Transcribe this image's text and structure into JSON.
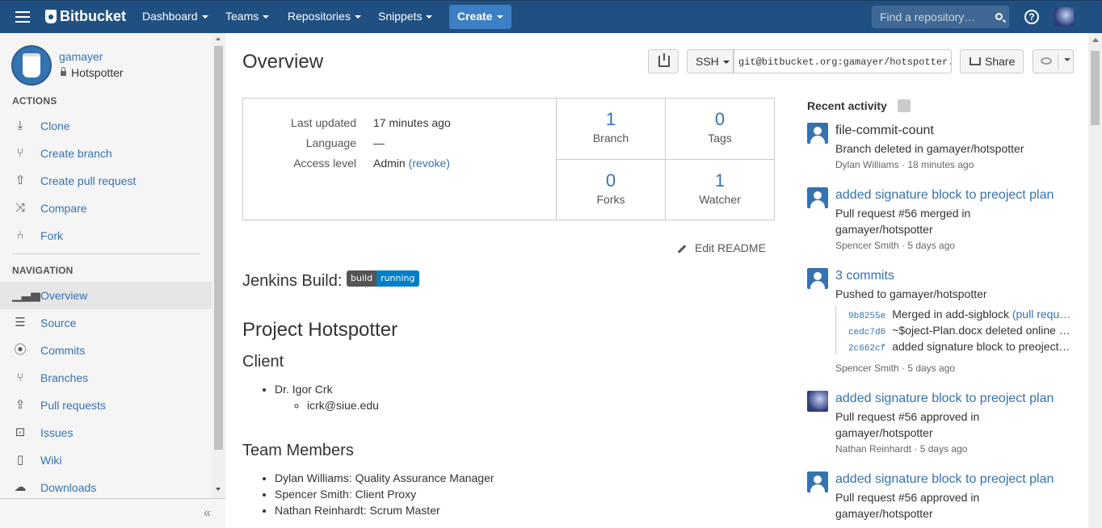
{
  "header": {
    "logo": "Bitbucket",
    "nav": [
      "Dashboard",
      "Teams",
      "Repositories",
      "Snippets"
    ],
    "create_label": "Create",
    "search_placeholder": "Find a repository…",
    "help_label": "?"
  },
  "sidebar": {
    "owner": "gamayer",
    "repo": "Hotspotter",
    "actions_title": "ACTIONS",
    "actions": [
      {
        "label": "Clone",
        "icon": "download-icon"
      },
      {
        "label": "Create branch",
        "icon": "create-branch-icon"
      },
      {
        "label": "Create pull request",
        "icon": "create-pull-request-icon"
      },
      {
        "label": "Compare",
        "icon": "compare-icon"
      },
      {
        "label": "Fork",
        "icon": "fork-icon"
      }
    ],
    "navigation_title": "NAVIGATION",
    "navigation": [
      {
        "label": "Overview",
        "icon": "overview-icon",
        "active": true
      },
      {
        "label": "Source",
        "icon": "source-icon"
      },
      {
        "label": "Commits",
        "icon": "commits-icon"
      },
      {
        "label": "Branches",
        "icon": "branches-icon"
      },
      {
        "label": "Pull requests",
        "icon": "pull-requests-icon"
      },
      {
        "label": "Issues",
        "icon": "issues-icon"
      },
      {
        "label": "Wiki",
        "icon": "wiki-icon"
      },
      {
        "label": "Downloads",
        "icon": "downloads-icon"
      }
    ],
    "collapse_label": "«"
  },
  "main": {
    "title": "Overview",
    "protocol": "SSH",
    "clone_url": "git@bitbucket.org:gamayer/hotspotter.git",
    "share_label": "Share",
    "meta": {
      "last_updated_key": "Last updated",
      "last_updated_val": "17 minutes ago",
      "language_key": "Language",
      "language_val": "—",
      "access_key": "Access level",
      "access_val": "Admin",
      "revoke_label": "(revoke)"
    },
    "stats": {
      "branch_count": "1",
      "branch_label": "Branch",
      "tags_count": "0",
      "tags_label": "Tags",
      "forks_count": "0",
      "forks_label": "Forks",
      "watcher_count": "1",
      "watcher_label": "Watcher"
    },
    "edit_readme": "Edit README",
    "readme": {
      "jenkins_label": "Jenkins Build:",
      "badge_left": "build",
      "badge_right": "running",
      "project_title": "Project Hotspotter",
      "client_heading": "Client",
      "client_name": "Dr. Igor Crk",
      "client_email": "icrk@siue.edu",
      "team_heading": "Team Members",
      "team": [
        "Dylan Williams: Quality Assurance Manager",
        "Spencer Smith: Client Proxy",
        "Nathan Reinhardt: Scrum Master"
      ]
    }
  },
  "activity": {
    "title": "Recent activity",
    "items": [
      {
        "head": "file-commit-count",
        "text": "Branch deleted in gamayer/hotspotter",
        "meta": "Dylan Williams · 18 minutes ago"
      },
      {
        "head": "added signature block to preoject plan",
        "text": "Pull request #56 merged in gamayer/hotspotter",
        "meta": "Spencer Smith · 5 days ago"
      },
      {
        "head": "3 commits",
        "text": "Pushed to gamayer/hotspotter",
        "meta": "Spencer Smith · 5 days ago"
      },
      {
        "head": "added signature block to preoject plan",
        "text": "Pull request #56 approved in gamayer/hotspotter",
        "meta": "Nathan Reinhardt · 5 days ago"
      },
      {
        "head": "added signature block to preoject plan",
        "text": "Pull request #56 approved in gamayer/hotspotter",
        "meta": ""
      }
    ],
    "commits": [
      {
        "hash": "9b8255e",
        "msg": "Merged in add-sigblock",
        "link": "(pull requ…"
      },
      {
        "hash": "cedc7d6",
        "msg": "~$oject-Plan.docx deleted online …"
      },
      {
        "hash": "2c662cf",
        "msg": "added signature block to preoject…"
      }
    ]
  }
}
